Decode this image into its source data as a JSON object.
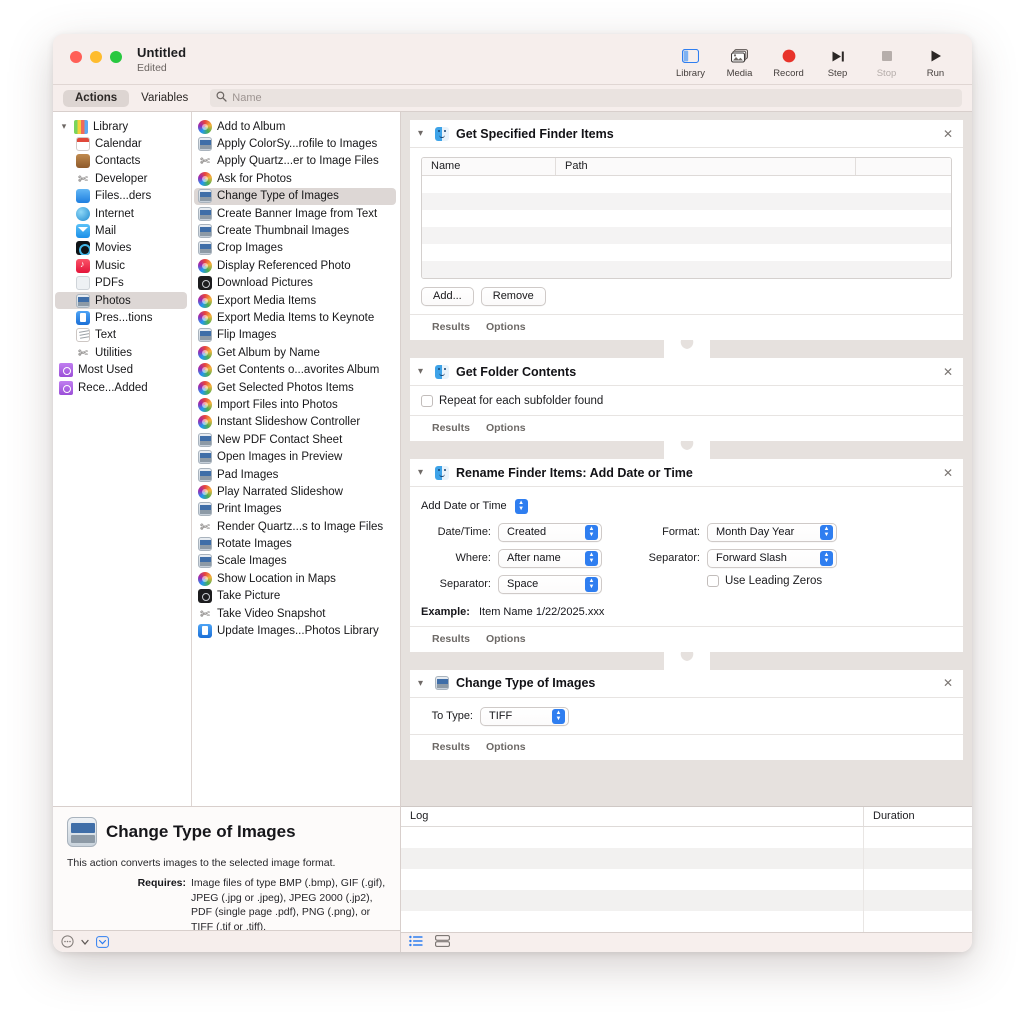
{
  "window": {
    "title": "Untitled",
    "subtitle": "Edited"
  },
  "toolbar": {
    "items": [
      {
        "label": "Library",
        "icon": "sidebar-icon",
        "disabled": false
      },
      {
        "label": "Media",
        "icon": "media-icon",
        "disabled": false
      },
      {
        "label": "Record",
        "icon": "record-icon",
        "disabled": false
      },
      {
        "label": "Step",
        "icon": "step-icon",
        "disabled": false
      },
      {
        "label": "Stop",
        "icon": "stop-icon",
        "disabled": true
      },
      {
        "label": "Run",
        "icon": "run-icon",
        "disabled": false
      }
    ]
  },
  "tabs": {
    "actions": "Actions",
    "variables": "Variables"
  },
  "search": {
    "placeholder": "Name",
    "value": ""
  },
  "library": {
    "root": "Library",
    "items": [
      {
        "label": "Calendar",
        "icon": "calendar-icon",
        "selected": false
      },
      {
        "label": "Contacts",
        "icon": "contacts-icon",
        "selected": false
      },
      {
        "label": "Developer",
        "icon": "developer-icon",
        "selected": false
      },
      {
        "label": "Files...ders",
        "icon": "files-icon",
        "selected": false
      },
      {
        "label": "Internet",
        "icon": "internet-icon",
        "selected": false
      },
      {
        "label": "Mail",
        "icon": "mail-icon",
        "selected": false
      },
      {
        "label": "Movies",
        "icon": "movies-icon",
        "selected": false
      },
      {
        "label": "Music",
        "icon": "music-icon",
        "selected": false
      },
      {
        "label": "PDFs",
        "icon": "pdf-icon",
        "selected": false
      },
      {
        "label": "Photos",
        "icon": "photos-icon",
        "selected": true
      },
      {
        "label": "Pres...tions",
        "icon": "keynote-icon",
        "selected": false
      },
      {
        "label": "Text",
        "icon": "text-icon",
        "selected": false
      },
      {
        "label": "Utilities",
        "icon": "utilities-icon",
        "selected": false
      }
    ],
    "groups": [
      {
        "label": "Most Used",
        "icon": "folder-icon"
      },
      {
        "label": "Rece...Added",
        "icon": "folder-icon"
      }
    ]
  },
  "actions_list": [
    {
      "label": "Add to Album",
      "icon": "photos-app-icon",
      "selected": false
    },
    {
      "label": "Apply ColorSy...rofile to Images",
      "icon": "image-icon",
      "selected": false
    },
    {
      "label": "Apply Quartz...er to Image Files",
      "icon": "utilities-icon",
      "selected": false
    },
    {
      "label": "Ask for Photos",
      "icon": "photos-app-icon",
      "selected": false
    },
    {
      "label": "Change Type of Images",
      "icon": "image-icon",
      "selected": true
    },
    {
      "label": "Create Banner Image from Text",
      "icon": "image-icon",
      "selected": false
    },
    {
      "label": "Create Thumbnail Images",
      "icon": "image-icon",
      "selected": false
    },
    {
      "label": "Crop Images",
      "icon": "image-icon",
      "selected": false
    },
    {
      "label": "Display Referenced Photo",
      "icon": "photos-app-icon",
      "selected": false
    },
    {
      "label": "Download Pictures",
      "icon": "camera-icon",
      "selected": false
    },
    {
      "label": "Export Media Items",
      "icon": "photos-app-icon",
      "selected": false
    },
    {
      "label": "Export Media Items to Keynote",
      "icon": "photos-app-icon",
      "selected": false
    },
    {
      "label": "Flip Images",
      "icon": "image-icon",
      "selected": false
    },
    {
      "label": "Get Album by Name",
      "icon": "photos-app-icon",
      "selected": false
    },
    {
      "label": "Get Contents o...avorites Album",
      "icon": "photos-app-icon",
      "selected": false
    },
    {
      "label": "Get Selected Photos Items",
      "icon": "photos-app-icon",
      "selected": false
    },
    {
      "label": "Import Files into Photos",
      "icon": "photos-app-icon",
      "selected": false
    },
    {
      "label": "Instant Slideshow Controller",
      "icon": "photos-app-icon",
      "selected": false
    },
    {
      "label": "New PDF Contact Sheet",
      "icon": "image-icon",
      "selected": false
    },
    {
      "label": "Open Images in Preview",
      "icon": "image-icon",
      "selected": false
    },
    {
      "label": "Pad Images",
      "icon": "image-icon",
      "selected": false
    },
    {
      "label": "Play Narrated Slideshow",
      "icon": "photos-app-icon",
      "selected": false
    },
    {
      "label": "Print Images",
      "icon": "image-icon",
      "selected": false
    },
    {
      "label": "Render Quartz...s to Image Files",
      "icon": "utilities-icon",
      "selected": false
    },
    {
      "label": "Rotate Images",
      "icon": "image-icon",
      "selected": false
    },
    {
      "label": "Scale Images",
      "icon": "image-icon",
      "selected": false
    },
    {
      "label": "Show Location in Maps",
      "icon": "photos-app-icon",
      "selected": false
    },
    {
      "label": "Take Picture",
      "icon": "camera-icon",
      "selected": false
    },
    {
      "label": "Take Video Snapshot",
      "icon": "utilities-icon",
      "selected": false
    },
    {
      "label": "Update Images...Photos Library",
      "icon": "keynote-icon",
      "selected": false
    }
  ],
  "description": {
    "title": "Change Type of Images",
    "icon": "image-icon",
    "summary": "This action converts images to the selected image format.",
    "requires_label": "Requires:",
    "requires_value": "Image files of type BMP (.bmp), GIF (.gif), JPEG (.jpg or .jpeg), JPEG 2000 (.jp2), PDF (single page .pdf), PNG (.png), or TIFF (.tif or .tiff)."
  },
  "status_bar": {
    "left_icon": "more-options-icon",
    "chevron_icon": "chevron-down-icon",
    "right_icon": "comment-icon"
  },
  "workflow": {
    "actions": [
      {
        "title": "Get Specified Finder Items",
        "icon": "finder-icon",
        "close_icon": "close-icon",
        "chevron_icon": "chevron-down-icon",
        "kind": "finder-items",
        "table": {
          "columns": [
            "Name",
            "Path"
          ],
          "rows": []
        },
        "buttons": [
          "Add...",
          "Remove"
        ],
        "footer": [
          "Results",
          "Options"
        ]
      },
      {
        "title": "Get Folder Contents",
        "icon": "finder-icon",
        "close_icon": "close-icon",
        "chevron_icon": "chevron-down-icon",
        "kind": "folder-contents",
        "checkbox_label": "Repeat for each subfolder found",
        "checkbox_checked": false,
        "footer": [
          "Results",
          "Options"
        ]
      },
      {
        "title": "Rename Finder Items: Add Date or Time",
        "icon": "finder-icon",
        "close_icon": "close-icon",
        "chevron_icon": "chevron-down-icon",
        "kind": "rename",
        "mode_popup": "Add Date or Time",
        "fields_left": [
          {
            "label": "Date/Time:",
            "value": "Created"
          },
          {
            "label": "Where:",
            "value": "After name"
          },
          {
            "label": "Separator:",
            "value": "Space"
          }
        ],
        "fields_right": [
          {
            "label": "Format:",
            "value": "Month Day Year"
          },
          {
            "label": "Separator:",
            "value": "Forward Slash"
          }
        ],
        "leading_zeros_label": "Use Leading Zeros",
        "leading_zeros_checked": false,
        "example_label": "Example:",
        "example_value": "Item Name 1/22/2025.xxx",
        "footer": [
          "Results",
          "Options"
        ]
      },
      {
        "title": "Change Type of Images",
        "icon": "image-icon",
        "close_icon": "close-icon",
        "chevron_icon": "chevron-down-icon",
        "kind": "change-type",
        "field_label": "To Type:",
        "field_value": "TIFF",
        "footer": [
          "Results",
          "Options"
        ]
      }
    ]
  },
  "log": {
    "columns": {
      "log": "Log",
      "duration": "Duration"
    },
    "rows": []
  },
  "log_bar": {
    "list_icon": "list-view-icon",
    "split_icon": "split-view-icon"
  },
  "colors": {
    "accent": "#2f7ef0",
    "record": "#e8332a",
    "window_bg": "#f6eeec",
    "workflow_bg": "#e6e1de",
    "selection": "#ddd7d5"
  }
}
